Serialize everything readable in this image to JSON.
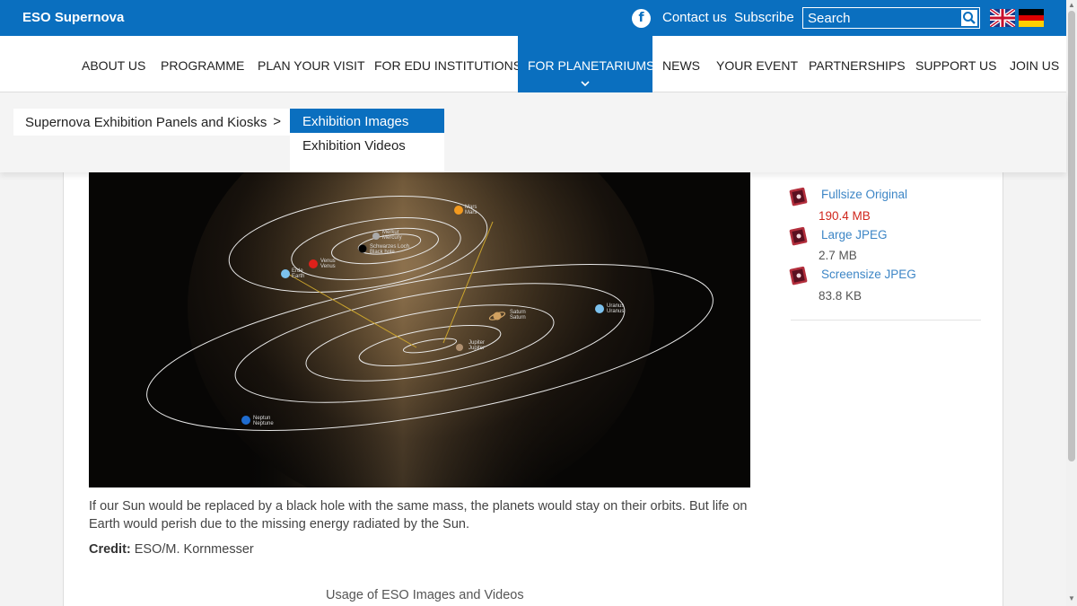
{
  "topbar": {
    "brand": "ESO Supernova",
    "contact_label": "Contact us",
    "subscribe_label": "Subscribe",
    "search_placeholder": "Search",
    "icons": [
      "facebook-icon",
      "search-icon",
      "flag-uk-icon",
      "flag-de-icon"
    ]
  },
  "nav": {
    "items": [
      {
        "label": "ABOUT US"
      },
      {
        "label": "PROGRAMME"
      },
      {
        "label": "PLAN YOUR VISIT"
      },
      {
        "label": "FOR EDU INSTITUTIONS"
      },
      {
        "label": "FOR PLANETARIUMS"
      },
      {
        "label": "NEWS"
      },
      {
        "label": "YOUR EVENT"
      },
      {
        "label": "PARTNERSHIPS"
      },
      {
        "label": "SUPPORT US"
      },
      {
        "label": "JOIN US"
      }
    ],
    "active": "FOR PLANETARIUMS"
  },
  "dropdown": {
    "main_item": "Supernova Exhibition Panels and Kiosks",
    "main_arrow": ">",
    "sub_items": [
      {
        "label": "Exhibition Images"
      },
      {
        "label": "Exhibition Videos"
      }
    ],
    "active": "Exhibition Images"
  },
  "figure": {
    "labels": {
      "mars": [
        "Mars",
        "Mars"
      ],
      "mercury": [
        "Merkur",
        "Mercury"
      ],
      "blackhole": [
        "Schwarzes Loch",
        "Black hole"
      ],
      "venus": [
        "Venus",
        "Venus"
      ],
      "earth": [
        "Erde",
        "Earth"
      ],
      "saturn": [
        "Saturn",
        "Saturn"
      ],
      "uranus": [
        "Uranus",
        "Uranus"
      ],
      "jupiter": [
        "Jupiter",
        "Jupiter"
      ],
      "neptune": [
        "Neptun",
        "Neptune"
      ]
    }
  },
  "main": {
    "caption": "If our Sun would be replaced by a black hole with the same mass, the planets would stay on their orbits. But life on Earth would perish due to the missing energy radiated by the Sun.",
    "credit_label": "Credit:",
    "credit_value": "ESO/M. Kornmesser",
    "usage_link": "Usage of ESO Images and Videos"
  },
  "downloads": {
    "items": [
      {
        "label": "Fullsize Original",
        "size": "190.4 MB",
        "size_color": "#d0261c"
      },
      {
        "label": "Large JPEG",
        "size": "2.7 MB"
      },
      {
        "label": "Screensize JPEG",
        "size": "83.8 KB"
      }
    ]
  },
  "colors": {
    "brand_blue": "#0a6fbf",
    "link": "#3d86c6",
    "warning_red": "#d0261c"
  }
}
